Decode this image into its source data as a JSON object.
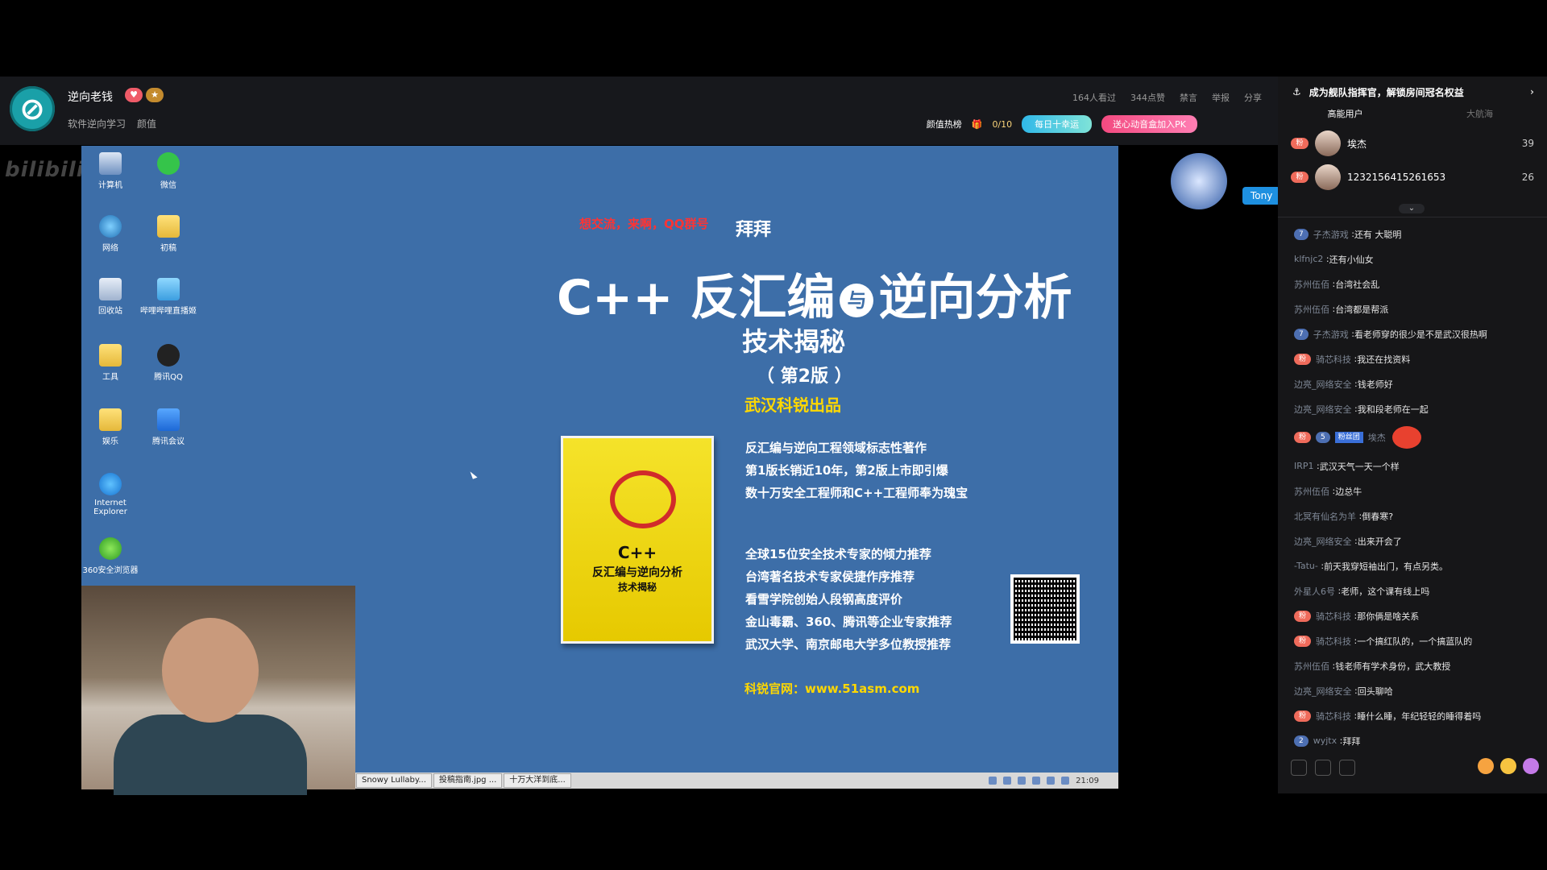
{
  "header": {
    "streamer_name": "逆向老钱",
    "categories": [
      "软件逆向学习",
      "颜值"
    ],
    "stats": [
      "164人看过",
      "344点赞",
      "禁言",
      "举报",
      "分享"
    ],
    "heat_label": "颜值热榜",
    "gift_count": "0/10",
    "daily_lucky": "每日十幸运",
    "pk_label": "送心动音盒加入PK"
  },
  "video": {
    "watermark": "bilibili直播",
    "desktop_icons": [
      "计算机",
      "微信",
      "网络",
      "初稿",
      "回收站",
      "哔哩哔哩直播姬",
      "工具",
      "腾讯QQ",
      "娱乐",
      "腾讯会议",
      "Internet Explorer",
      "360安全浏览器"
    ],
    "banner_red": "想交流，来啊，QQ群号",
    "overlay_text": "拜拜",
    "book_title_a": "C++ 反汇编",
    "book_title_yu": "与",
    "book_title_b": "逆向分析",
    "book_subtitle": "技术揭秘",
    "book_edition": "（ 第2版 ）",
    "publisher": "武汉科锐出品",
    "features_1": [
      "反汇编与逆向工程领域标志性著作",
      "第1版长销近10年，第2版上市即引爆",
      "数十万安全工程师和C++工程师奉为瑰宝"
    ],
    "features_2": [
      "全球15位安全技术专家的倾力推荐",
      "台湾著名技术专家侯捷作序推荐",
      "看雪学院创始人段钢高度评价",
      "金山毒霸、360、腾讯等企业专家推荐",
      "武汉大学、南京邮电大学多位教授推荐"
    ],
    "cover_title_1": "C++",
    "cover_title_2": "反汇编与逆向分析",
    "cover_title_3": "技术揭秘",
    "website": "科锐官网：www.51asm.com",
    "taskbar_items": [
      "Snowy Lullaby...",
      "投稿指南.jpg ...",
      "十万大洋到底..."
    ],
    "clock": "21:09",
    "tony_tag": "Tony"
  },
  "sidebar": {
    "promo": "成为舰队指挥官，解锁房间冠名权益",
    "tabs": [
      "高能用户",
      "大航海"
    ],
    "ranks": [
      {
        "badge": "粉",
        "name": "埃杰",
        "score": "39"
      },
      {
        "badge": "粉",
        "name": "1232156415261653",
        "score": "26"
      }
    ],
    "chat": [
      {
        "lv": "7",
        "user": "子杰游戏",
        "text": "还有 大聪明"
      },
      {
        "user": "klfnjc2",
        "text": "还有小仙女"
      },
      {
        "user": "苏州伍佰",
        "text": "台湾社会乱"
      },
      {
        "user": "苏州伍佰",
        "text": "台湾都是帮派"
      },
      {
        "lv": "7",
        "user": "子杰游戏",
        "text": "看老师穿的很少是不是武汉很热啊"
      },
      {
        "fan": "粉",
        "user": "骑芯科技",
        "text": "我还在找资料"
      },
      {
        "user": "边亮_网络安全",
        "text": "钱老师好"
      },
      {
        "user": "边亮_网络安全",
        "text": "我和段老师在一起"
      },
      {
        "fan": "粉",
        "lv": "5",
        "fanclub": "粉丝团",
        "user": "埃杰",
        "text": ""
      },
      {
        "user": "IRP1",
        "text": "武汉天气一天一个样"
      },
      {
        "user": "苏州伍佰",
        "text": "边总牛"
      },
      {
        "user": "北冥有仙名为羊",
        "text": "倒春寒?"
      },
      {
        "user": "边亮_网络安全",
        "text": "出来开会了"
      },
      {
        "user": "-Tatu-",
        "text": "前天我穿短袖出门，有点另类。"
      },
      {
        "user": "外星人6号",
        "text": "老师，这个课有线上吗"
      },
      {
        "fan": "粉",
        "user": "骑芯科技",
        "text": "那你俩是啥关系"
      },
      {
        "fan": "粉",
        "user": "骑芯科技",
        "text": "一个搞红队的，一个搞蓝队的"
      },
      {
        "user": "苏州伍佰",
        "text": "钱老师有学术身份，武大教授"
      },
      {
        "user": "边亮_网络安全",
        "text": "回头聊哈"
      },
      {
        "fan": "粉",
        "user": "骑芯科技",
        "text": "睡什么睡，年纪轻轻的睡得着吗"
      },
      {
        "lv": "2",
        "user": "wyjtx",
        "text": "拜拜"
      }
    ]
  }
}
